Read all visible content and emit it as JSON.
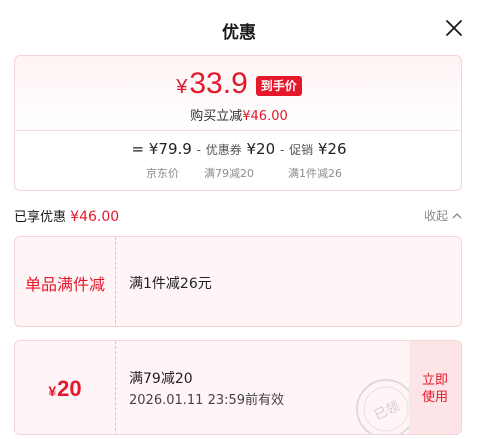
{
  "header": {
    "title": "优惠"
  },
  "summary": {
    "currency": "¥",
    "final_price": "33.9",
    "final_tag": "到手价",
    "save_prefix": "购买立减",
    "save_amount": "¥46.00",
    "eq": "=",
    "base_price": "¥79.9",
    "minus": "-",
    "coupon_label": "优惠券",
    "coupon_value": "¥20",
    "promo_label": "促销",
    "promo_value": "¥26",
    "labels": {
      "base": "京东价",
      "coupon": "满79减20",
      "promo": "满1件减26"
    }
  },
  "enjoyed": {
    "prefix": "已享优惠",
    "amount": "¥46.00",
    "collapse_label": "收起"
  },
  "promo_card": {
    "type": "单品满件减",
    "desc": "满1件减26元"
  },
  "coupon_card": {
    "currency": "¥",
    "amount": "20",
    "condition": "满79减20",
    "validity": "2026.01.11 23:59前有效",
    "button": "立即使用",
    "stamp": "已领"
  },
  "colors": {
    "accent": "#e5182b",
    "card_border": "#f6d3d6",
    "card_bg": "#fff5f6"
  },
  "icons": {
    "close": "close-icon",
    "collapse": "chevron-up-icon",
    "stamp": "claimed-stamp-icon"
  }
}
